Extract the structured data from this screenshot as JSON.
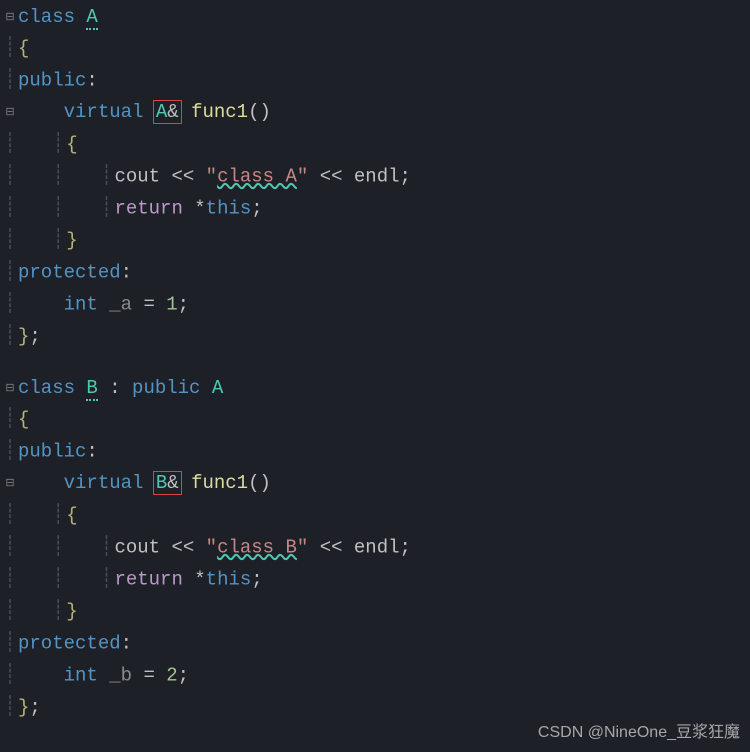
{
  "code": {
    "classA": {
      "keyword_class": "class",
      "name": "A",
      "public_kw": "public",
      "virtual_kw": "virtual",
      "return_type": "A",
      "amp": "&",
      "func_name": "func1",
      "parens": "()",
      "cout_kw": "cout",
      "stream_op": " << ",
      "string_lit": "\"class A\"",
      "endl_kw": "endl",
      "return_kw": "return",
      "deref": "*",
      "this_kw": "this",
      "semi": ";",
      "protected_kw": "protected",
      "int_kw": "int",
      "member_name": "_a",
      "equals": " = ",
      "member_val": "1"
    },
    "classB": {
      "keyword_class": "class",
      "name": "B",
      "colon": " : ",
      "public_inherit": "public",
      "base": "A",
      "public_kw": "public",
      "virtual_kw": "virtual",
      "return_type": "B",
      "amp": "&",
      "func_name": "func1",
      "parens": "()",
      "cout_kw": "cout",
      "stream_op": " << ",
      "string_lit": "\"class B\"",
      "endl_kw": "endl",
      "return_kw": "return",
      "deref": "*",
      "this_kw": "this",
      "semi": ";",
      "protected_kw": "protected",
      "int_kw": "int",
      "member_name": "_b",
      "equals": " = ",
      "member_val": "2"
    },
    "string_inner_A": "class A",
    "string_inner_B": "class B"
  },
  "glyphs": {
    "fold_minus": "⊟",
    "guide": "┊"
  },
  "watermark": "CSDN @NineOne_豆浆狂魔"
}
